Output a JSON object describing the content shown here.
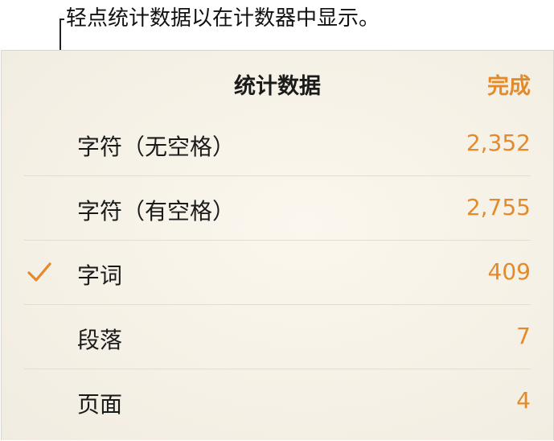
{
  "callout": {
    "text": "轻点统计数据以在计数器中显示。"
  },
  "panel": {
    "title": "统计数据",
    "done_label": "完成"
  },
  "rows": [
    {
      "label": "字符（无空格）",
      "value": "2,352",
      "checked": false
    },
    {
      "label": "字符（有空格）",
      "value": "2,755",
      "checked": false
    },
    {
      "label": "字词",
      "value": "409",
      "checked": true
    },
    {
      "label": "段落",
      "value": "7",
      "checked": false
    },
    {
      "label": "页面",
      "value": "4",
      "checked": false
    }
  ],
  "colors": {
    "accent": "#e38b2a",
    "text": "#1a1a1a",
    "divider": "#e2ddd2"
  },
  "icons": {
    "checkmark": "checkmark-icon"
  }
}
